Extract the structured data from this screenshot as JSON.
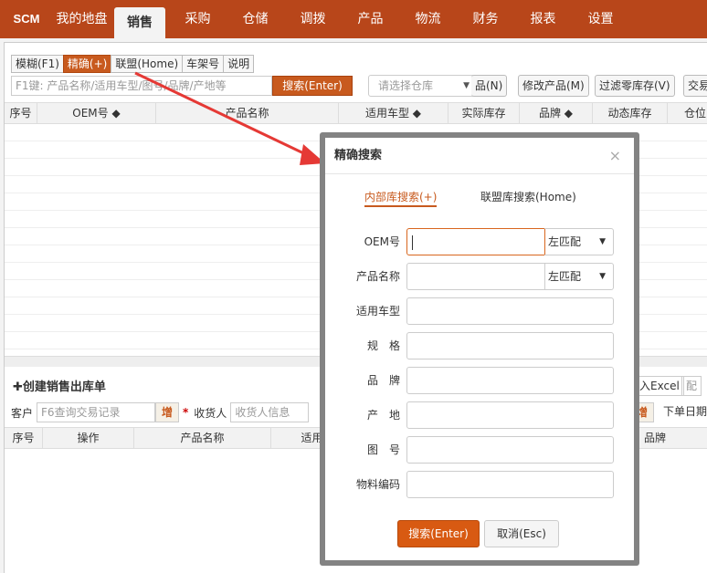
{
  "nav": {
    "brand": "SCM",
    "tabs": [
      "我的地盘",
      "销售",
      "采购",
      "仓储",
      "调拨",
      "产品",
      "物流",
      "财务",
      "报表",
      "设置"
    ],
    "active_index": 1
  },
  "search_modes": {
    "tabs": [
      "模糊(F1)",
      "精确(+)",
      "联盟(Home)",
      "车架号",
      "说明"
    ],
    "active_index": 1
  },
  "search": {
    "placeholder": "F1键: 产品名称/适用车型/图号/品牌/产地等",
    "button": "搜索(Enter)"
  },
  "warehouse_select": {
    "placeholder": "请选择仓库"
  },
  "toolbar": {
    "btn_partial": "品(N)",
    "btn_edit": "修改产品(M)",
    "btn_filter": "过滤零库存(V)",
    "btn_trade": "交易"
  },
  "product_grid": {
    "columns": [
      "序号",
      "OEM号 ◆",
      "产品名称",
      "适用车型 ◆",
      "实际库存",
      "品牌 ◆",
      "动态库存",
      "仓位"
    ]
  },
  "sales_order": {
    "title": "✚创建销售出库单",
    "customer_label": "客户",
    "customer_placeholder": "F6查询交易记录",
    "add_label": "增",
    "star": "*",
    "receiver_label": "收货人",
    "receiver_placeholder": "收货人信息",
    "import_partial": "入Excel",
    "config_partial": "配",
    "add_label2": "增",
    "date_label": "下单日期",
    "columns": [
      "序号",
      "操作",
      "产品名称",
      "适用",
      "品牌"
    ]
  },
  "modal": {
    "title": "精确搜索",
    "close": "×",
    "tabs": [
      "内部库搜索(+)",
      "联盟库搜索(Home)"
    ],
    "fields": [
      {
        "label": "OEM号",
        "match": "左匹配",
        "has_match": true,
        "focused": true
      },
      {
        "label": "产品名称",
        "match": "左匹配",
        "has_match": true,
        "focused": false
      },
      {
        "label": "适用车型",
        "has_match": false
      },
      {
        "label": "规　格",
        "has_match": false
      },
      {
        "label": "品　牌",
        "has_match": false
      },
      {
        "label": "产　地",
        "has_match": false
      },
      {
        "label": "图　号",
        "has_match": false
      },
      {
        "label": "物料编码",
        "has_match": false
      }
    ],
    "search_button": "搜索(Enter)",
    "cancel_button": "取消(Esc)"
  }
}
